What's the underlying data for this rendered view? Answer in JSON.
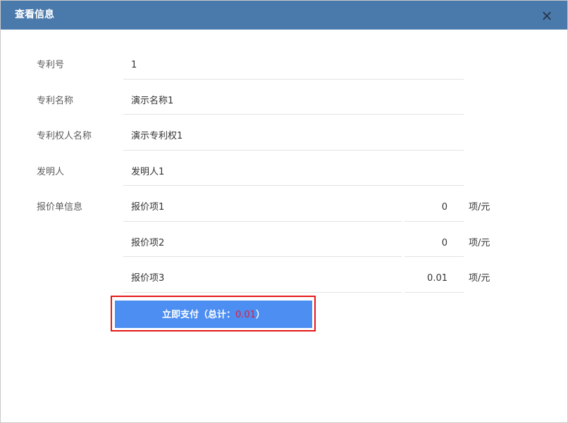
{
  "dialog": {
    "title": "查看信息",
    "close_symbol": "×"
  },
  "fields": {
    "patent_no": {
      "label": "专利号",
      "value": "1"
    },
    "patent_name": {
      "label": "专利名称",
      "value": "演示名称1"
    },
    "owner_name": {
      "label": "专利权人名称",
      "value": "演示专利权1"
    },
    "inventor": {
      "label": "发明人",
      "value": "发明人1"
    }
  },
  "quote": {
    "label": "报价单信息",
    "items": [
      {
        "name": "报价项1",
        "amount": "0",
        "unit": "项/元"
      },
      {
        "name": "报价项2",
        "amount": "0",
        "unit": "项/元"
      },
      {
        "name": "报价项3",
        "amount": "0.01",
        "unit": "项/元"
      }
    ]
  },
  "pay": {
    "prefix": "立即支付（总计：",
    "total": "0.01",
    "suffix": "）"
  },
  "colors": {
    "titlebar": "#4a79ab",
    "button": "#4d8ef2",
    "total": "#e01d3a",
    "highlight": "#e41818"
  }
}
